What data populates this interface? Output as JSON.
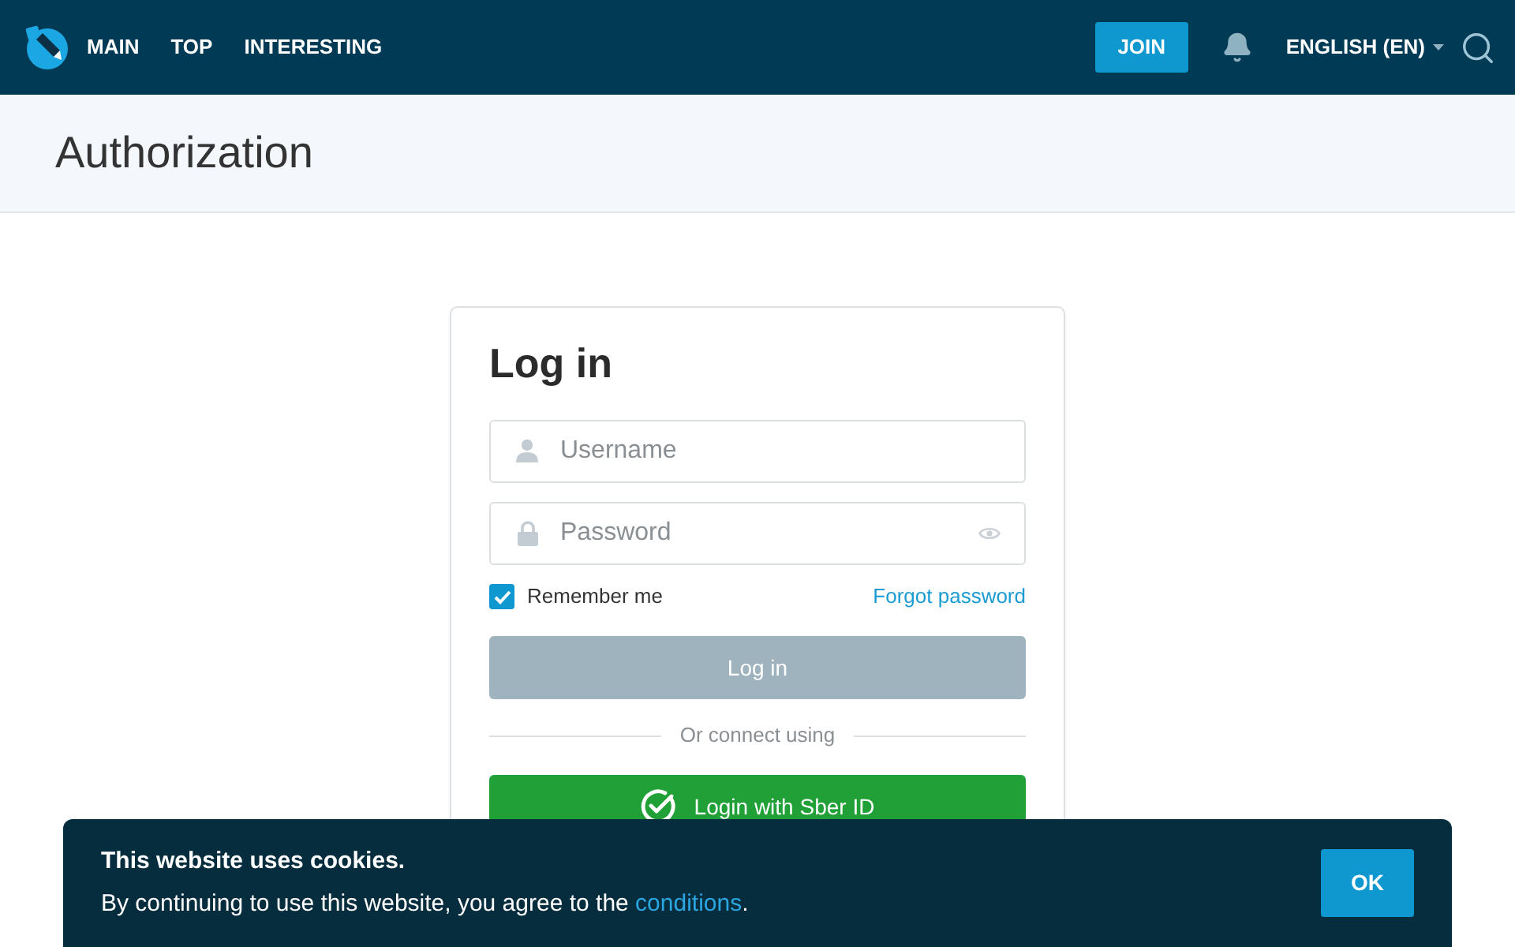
{
  "header": {
    "nav": [
      {
        "label": "MAIN"
      },
      {
        "label": "TOP"
      },
      {
        "label": "INTERESTING"
      }
    ],
    "join_button": "JOIN",
    "language": "ENGLISH (EN)"
  },
  "page_title": "Authorization",
  "login_card": {
    "title": "Log in",
    "fields": [
      {
        "kind": "username",
        "placeholder": "Username"
      },
      {
        "kind": "password",
        "placeholder": "Password"
      }
    ],
    "remember_me": {
      "label": "Remember me",
      "checked": true
    },
    "forgot_password": "Forgot password",
    "submit": {
      "label": "Log in",
      "disabled": true
    },
    "divider": "Or connect using",
    "sber_button": "Login with Sber ID"
  },
  "cookie_banner": {
    "title": "This website uses cookies.",
    "text": "By continuing to use this website, you agree to the ",
    "link": "conditions",
    "text_end": ".",
    "button": "OK"
  }
}
